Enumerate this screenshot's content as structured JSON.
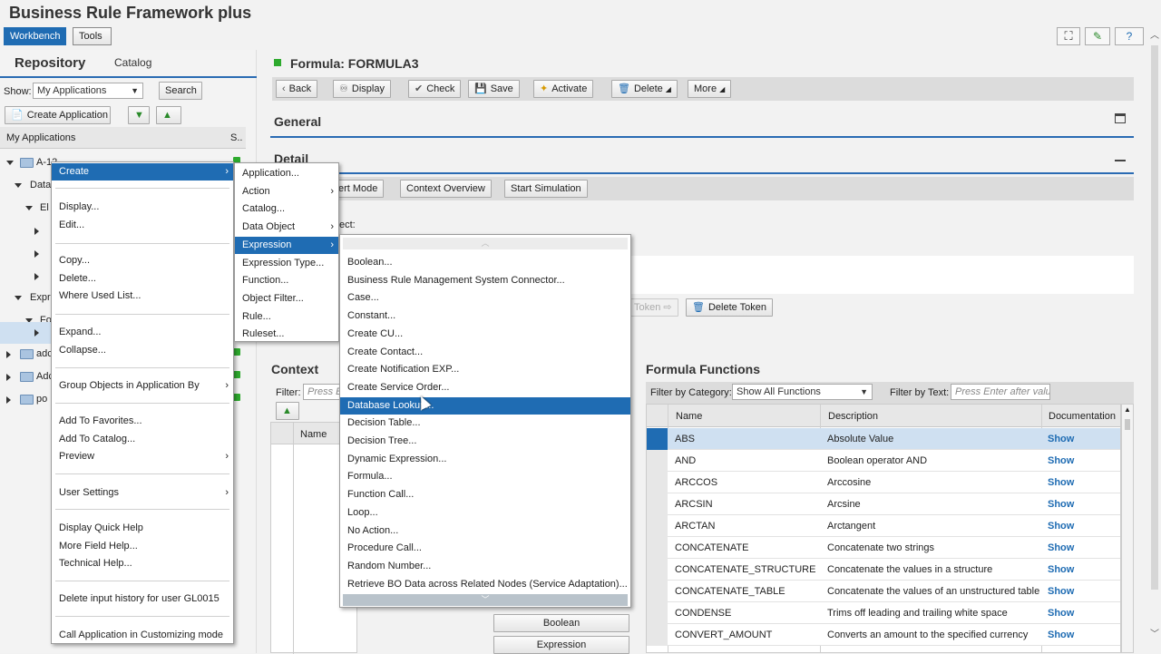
{
  "app": {
    "title": "Business Rule Framework plus",
    "tabs": [
      "Workbench",
      "Tools"
    ]
  },
  "left": {
    "tabs": [
      "Repository",
      "Catalog"
    ],
    "show_label": "Show:",
    "show_value": "My Applications",
    "search_label": "Search",
    "create_app_label": "Create Application",
    "col_header": "My Applications",
    "col_s": "S..",
    "tree": [
      "A-12",
      "Data",
      "El",
      "Expr",
      "Fo",
      "adc",
      "Adc",
      "po"
    ]
  },
  "main": {
    "header_title": "Formula: FORMULA3",
    "toolbar": [
      "Back",
      "Display",
      "Check",
      "Save",
      "Activate",
      "Delete",
      "More"
    ],
    "general_title": "General",
    "detail_title": "Detail",
    "detail_buttons": [
      "ert Mode",
      "Context Overview",
      "Start Simulation"
    ],
    "detail_label_partial": "ect:",
    "token_buttons": [
      "Token",
      "Delete Token"
    ],
    "context_title": "Context",
    "filter_label": "Filter:",
    "filter_placeholder": "Press E",
    "context_col_name": "Name",
    "type_buttons": [
      "Boolean",
      "Expression"
    ]
  },
  "formula_functions": {
    "title": "Formula Functions",
    "filter_by_category_label": "Filter by Category:",
    "category_value": "Show All Functions",
    "filter_by_text_label": "Filter by Text:",
    "text_placeholder": "Press Enter after valu",
    "columns": [
      "Name",
      "Description",
      "Documentation"
    ],
    "rows": [
      {
        "name": "ABS",
        "desc": "Absolute Value",
        "doc": "Show"
      },
      {
        "name": "AND",
        "desc": "Boolean operator AND",
        "doc": "Show"
      },
      {
        "name": "ARCCOS",
        "desc": "Arccosine",
        "doc": "Show"
      },
      {
        "name": "ARCSIN",
        "desc": "Arcsine",
        "doc": "Show"
      },
      {
        "name": "ARCTAN",
        "desc": "Arctangent",
        "doc": "Show"
      },
      {
        "name": "CONCATENATE",
        "desc": "Concatenate two strings",
        "doc": "Show"
      },
      {
        "name": "CONCATENATE_STRUCTURE",
        "desc": "Concatenate the values in a structure",
        "doc": "Show"
      },
      {
        "name": "CONCATENATE_TABLE",
        "desc": "Concatenate the values of an unstructured table",
        "doc": "Show"
      },
      {
        "name": "CONDENSE",
        "desc": "Trims off leading and trailing white space",
        "doc": "Show"
      },
      {
        "name": "CONVERT_AMOUNT",
        "desc": "Converts an amount to the specified currency",
        "doc": "Show"
      }
    ]
  },
  "context_menu": {
    "items": [
      "Create",
      "Display...",
      "Edit...",
      "Copy...",
      "Delete...",
      "Where Used List...",
      "Expand...",
      "Collapse...",
      "Group Objects in Application By",
      "Add To Favorites...",
      "Add To Catalog...",
      "Preview",
      "User Settings",
      "Display Quick Help",
      "More Field Help...",
      "Technical Help...",
      "Delete input history for user GL0015",
      "Call Application in Customizing mode"
    ]
  },
  "create_menu": {
    "items": [
      "Application...",
      "Action",
      "Catalog...",
      "Data Object",
      "Expression",
      "Expression Type...",
      "Function...",
      "Object Filter...",
      "Rule...",
      "Ruleset..."
    ]
  },
  "expression_menu": {
    "items": [
      "Boolean...",
      "Business Rule Management System Connector...",
      "Case...",
      "Constant...",
      "Create CU...",
      "Create Contact...",
      "Create Notification EXP...",
      "Create Service Order...",
      "Database Lookup...",
      "Decision Table...",
      "Decision Tree...",
      "Dynamic Expression...",
      "Formula...",
      "Function Call...",
      "Loop...",
      "No Action...",
      "Procedure Call...",
      "Random Number...",
      "Retrieve BO Data across Related Nodes (Service Adaptation)..."
    ]
  },
  "colors": {
    "accent": "#1f6cb3",
    "status_green": "#2eaa2e"
  }
}
